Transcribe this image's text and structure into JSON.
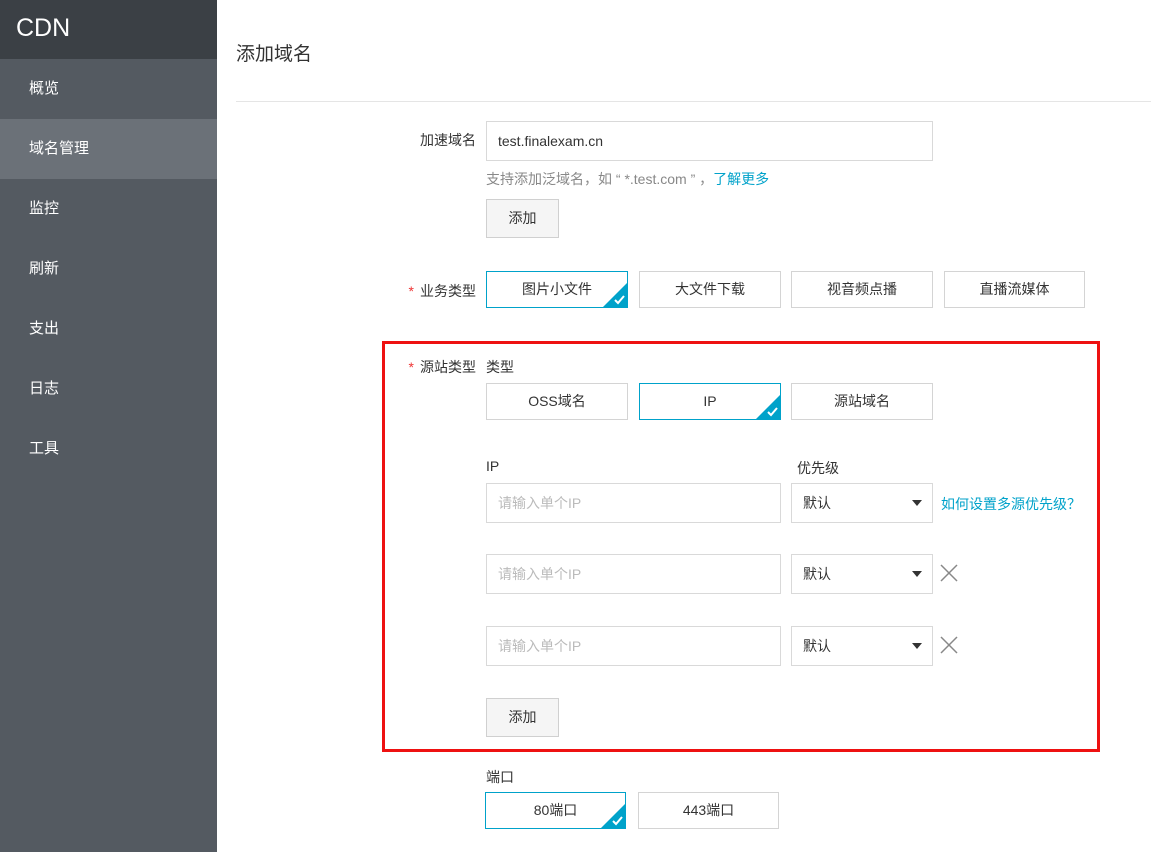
{
  "brand": "CDN",
  "sidebar": {
    "items": [
      {
        "label": "概览"
      },
      {
        "label": "域名管理"
      },
      {
        "label": "监控"
      },
      {
        "label": "刷新"
      },
      {
        "label": "支出"
      },
      {
        "label": "日志"
      },
      {
        "label": "工具"
      }
    ]
  },
  "page": {
    "title": "添加域名"
  },
  "domain_form": {
    "label": "加速域名",
    "value": "test.finalexam.cn",
    "hint_text": "支持添加泛域名，如 “ *.test.com ” ，",
    "hint_link": "了解更多",
    "add_label": "添加"
  },
  "business_type": {
    "label": "业务类型",
    "options": [
      "图片小文件",
      "大文件下载",
      "视音频点播",
      "直播流媒体"
    ],
    "selected": "图片小文件"
  },
  "origin": {
    "label": "源站类型",
    "type_label": "类型",
    "types": [
      "OSS域名",
      "IP",
      "源站域名"
    ],
    "selected": "IP",
    "ip_header": "IP",
    "priority_header": "优先级",
    "ip_placeholder": "请输入单个IP",
    "priority_value": "默认",
    "help_link": "如何设置多源优先级？",
    "add_label": "添加"
  },
  "port": {
    "label": "端口",
    "options": [
      "80端口",
      "443端口"
    ],
    "selected": "80端口"
  },
  "colors": {
    "sidebar": "#545a61",
    "sidebar_header": "#3b4045",
    "sidebar_active": "#6b7178",
    "accent": "#00a2ca",
    "highlight": "#ee1111"
  }
}
